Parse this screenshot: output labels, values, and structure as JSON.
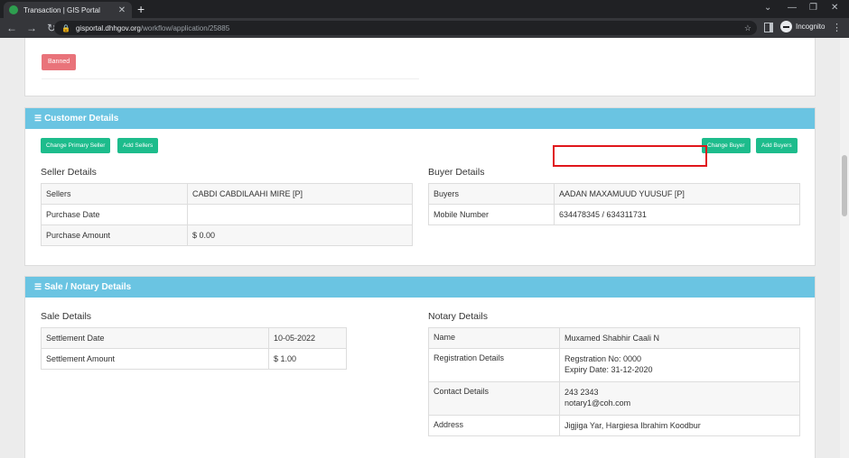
{
  "browser": {
    "tab_title": "Transaction | GIS Portal",
    "new_tab_glyph": "+",
    "url_host": "gisportal.dhhgov.org",
    "url_path": "/workflow/application/25885",
    "profile_label": "Incognito",
    "icons": [
      "favicon-icon",
      "close-icon",
      "back-icon",
      "forward-icon",
      "reload-icon",
      "lock-icon",
      "star-icon",
      "side-panel-icon",
      "incognito-icon",
      "menu-icon"
    ]
  },
  "top_card": {
    "banned_label": "Banned"
  },
  "customer": {
    "title": "Customer Details",
    "buttons": {
      "change_primary_seller": "Change Primary Seller",
      "add_sellers": "Add Sellers",
      "change_buyer": "Change Buyer",
      "add_buyers": "Add Buyers"
    },
    "seller": {
      "heading": "Seller Details",
      "rows": [
        {
          "label": "Sellers",
          "value": "CABDI CABDILAAHI MIRE [P]"
        },
        {
          "label": "Purchase Date",
          "value": ""
        },
        {
          "label": "Purchase Amount",
          "value": "$ 0.00"
        }
      ]
    },
    "buyer": {
      "heading": "Buyer Details",
      "rows": [
        {
          "label": "Buyers",
          "value": "AADAN MAXAMUUD YUUSUF [P]"
        },
        {
          "label": "Mobile Number",
          "value": "634478345 / 634311731"
        }
      ]
    }
  },
  "sale": {
    "title": "Sale / Notary Details",
    "sale_details": {
      "heading": "Sale Details",
      "rows": [
        {
          "label": "Settlement Date",
          "value": "10-05-2022"
        },
        {
          "label": "Settlement Amount",
          "value": "$ 1.00"
        }
      ]
    },
    "notary_details": {
      "heading": "Notary Details",
      "rows": [
        {
          "label": "Name",
          "lines": [
            "Muxamed Shabhir Caali N"
          ]
        },
        {
          "label": "Registration Details",
          "lines": [
            "Regstration No: 0000",
            "Expiry Date: 31-12-2020"
          ]
        },
        {
          "label": "Contact Details",
          "lines": [
            "243 2343",
            "notary1@coh.com"
          ]
        },
        {
          "label": "Address",
          "lines": [
            "Jigjiga Yar, Hargiesa Ibrahim Koodbur"
          ]
        }
      ]
    }
  },
  "colors": {
    "panel_header": "#6ac4e2",
    "green_button": "#1dbc8c",
    "banned_button": "#e9737a",
    "highlight_border": "#e0161b"
  }
}
